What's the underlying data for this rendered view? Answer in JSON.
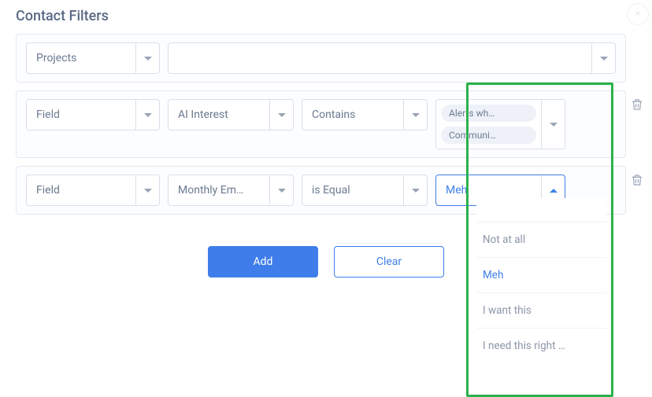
{
  "title": "Contact Filters",
  "row0": {
    "type_label": "Projects",
    "value_label": ""
  },
  "row1": {
    "col1": "Field",
    "col2": "AI Interest",
    "col3": "Contains",
    "tag1": "Alerts wh…",
    "tag2": "Communi…"
  },
  "row2": {
    "col1": "Field",
    "col2": "Monthly Em…",
    "col3": "is Equal",
    "col4": "Meh"
  },
  "buttons": {
    "add": "Add",
    "clear": "Clear"
  },
  "dropdown": {
    "opt0": "Not at all",
    "opt1": "Meh",
    "opt2": "I want this",
    "opt3": "I need this right …"
  }
}
